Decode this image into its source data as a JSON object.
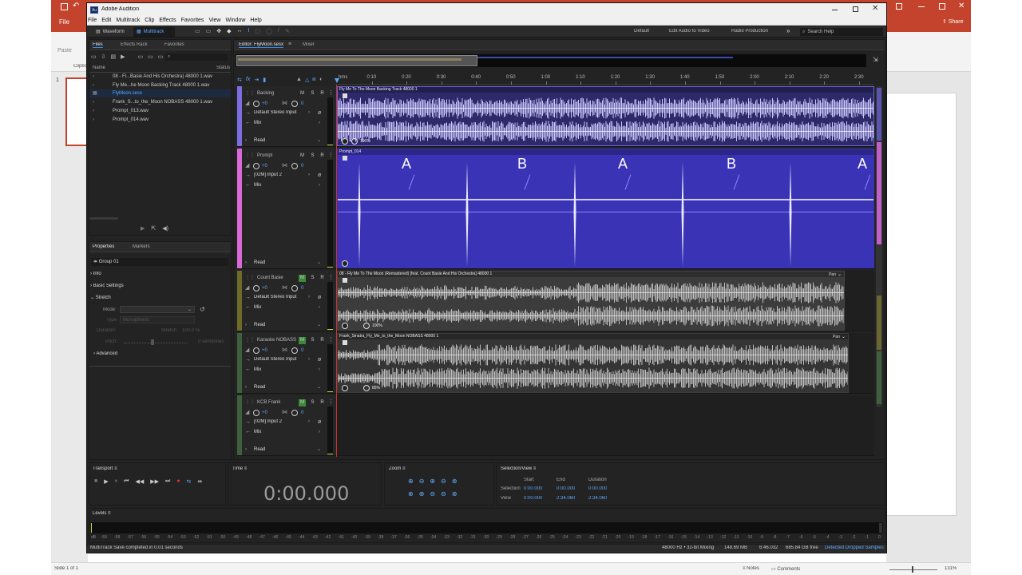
{
  "ppt": {
    "file_tab": "File",
    "undo_label": "Undo",
    "share_label": "Share",
    "clipboard_label": "Clipbo",
    "paste_label": "Paste",
    "slide_number": "1",
    "status_slide": "Slide 1 of 1",
    "notes_label": "Notes",
    "comments_label": "Comments",
    "zoom_level": "131%",
    "theme_color": "#c4432c"
  },
  "app": {
    "title": "Adobe Audition",
    "menu": [
      "File",
      "Edit",
      "Multitrack",
      "Clip",
      "Effects",
      "Favorites",
      "View",
      "Window",
      "Help"
    ],
    "toolbar": {
      "waveform_label": "Waveform",
      "multitrack_label": "Multitrack"
    },
    "workspaces": [
      "Default",
      "Edit Audio to Video",
      "Radio Production"
    ],
    "search_placeholder": "Search Help",
    "accent": "#2d8ceb"
  },
  "files_panel": {
    "tabs": [
      "Files",
      "Effects Rack",
      "Favorites"
    ],
    "col_name": "Name",
    "col_status": "Status",
    "items": [
      "08 - Fl...Basie And His Orchestra) 48000 1.wav",
      "Fly Me...he Moon Backing Track 48000 1.wav",
      "FlyMoon.sesx",
      "Frank_S...to_the_Moon NOBASS 48000 1.wav",
      "Prompt_013.wav",
      "Prompt_014.wav"
    ],
    "selected_index": 2
  },
  "properties_panel": {
    "tabs": [
      "Properties",
      "Markers"
    ],
    "group_value": "Group 01",
    "sections": [
      "Info",
      "Basic Settings",
      "Stretch",
      "Advanced"
    ],
    "mode_label": "Mode:",
    "type_label": "Type",
    "type_value": "Monophonic",
    "duration_label": "Duration:",
    "stretch_label": "Stretch:",
    "stretch_value": "100.0 %",
    "pitch_label": "Pitch:",
    "pitch_value": "0 semitones"
  },
  "editor": {
    "tabs": [
      "Editor: FlyMoon.sesx",
      "Mixer"
    ],
    "timecode_ticks": [
      "hms",
      "0:10",
      "0:20",
      "0:30",
      "0:40",
      "0:50",
      "1:00",
      "1:10",
      "1:20",
      "1:30",
      "1:40",
      "1:50",
      "2:00",
      "2:10",
      "2:20",
      "2:30"
    ],
    "tracks": [
      {
        "name": "Backing",
        "input": "Default Stereo Input",
        "mix": "Mix",
        "read": "Read",
        "vol": "+0",
        "pan": "0",
        "clip": "Fly Me To The Moon Backing Track 48000 1",
        "color": "#7c6ee0",
        "gain": "100%"
      },
      {
        "name": "Prompt",
        "input": "[02M] Input 2",
        "mix": "Mix",
        "read": "Read",
        "vol": "+0",
        "pan": "0",
        "clip": "Prompt_014",
        "color": "#d86ad8",
        "gain": ""
      },
      {
        "name": "Count Basie",
        "input": "Default Stereo Input",
        "mix": "Mix",
        "read": "Read",
        "vol": "+0",
        "pan": "0",
        "clip": "08 - Fly Me To The Moon (Remastered) [feat. Count Basie And His Orchestra] 48000 1",
        "color": "#6e6a2a",
        "gain": "100%",
        "pan_label": "Pan"
      },
      {
        "name": "Karaoke NOBASS",
        "input": "Default Stereo Input",
        "mix": "Mix",
        "read": "Read",
        "vol": "+0",
        "pan": "0",
        "clip": "Frank_Sinatra_Fly_Me_to_the_Moon NOBASS 48000 1",
        "color": "#3f5f3f",
        "gain": "85%",
        "pan_label": "Pan"
      },
      {
        "name": "KCB Frank",
        "input": "[02M] Input 2",
        "mix": "Mix",
        "read": "Read",
        "vol": "+0",
        "pan": "0",
        "clip": "",
        "color": "#3f5f3f",
        "gain": ""
      }
    ],
    "markers": [
      "A",
      "B",
      "A",
      "B",
      "A"
    ],
    "button_m": "M",
    "button_s": "S",
    "button_r": "R"
  },
  "transport": {
    "title": "Transport",
    "time_title": "Time",
    "time_value": "0:00.000",
    "zoom_title": "Zoom",
    "selection_title": "Selection/View",
    "col_start": "Start",
    "col_end": "End",
    "col_duration": "Duration",
    "row_selection": "Selection",
    "row_view": "View",
    "selection": [
      "0:00.000",
      "0:00.000",
      "0:00.000"
    ],
    "view": [
      "0:00.000",
      "2:34.060",
      "2:34.060"
    ]
  },
  "levels": {
    "title": "Levels",
    "scale": [
      "dB",
      "-59",
      "-58",
      "-57",
      "-56",
      "-55",
      "-54",
      "-53",
      "-52",
      "-51",
      "-50",
      "-49",
      "-48",
      "-47",
      "-46",
      "-45",
      "-44",
      "-43",
      "-42",
      "-41",
      "-40",
      "-39",
      "-38",
      "-37",
      "-36",
      "-35",
      "-34",
      "-33",
      "-32",
      "-31",
      "-30",
      "-29",
      "-28",
      "-27",
      "-26",
      "-25",
      "-24",
      "-23",
      "-22",
      "-21",
      "-20",
      "-19",
      "-18",
      "-17",
      "-16",
      "-15",
      "-14",
      "-13",
      "-12",
      "-11",
      "-10",
      "-9",
      "-8",
      "-7",
      "-6",
      "-5",
      "-4",
      "-3",
      "-2",
      "-1",
      "0"
    ]
  },
  "status": {
    "message": "MultiTrack Save completed in 0.01 seconds",
    "sample_info": "48000 Hz • 32-bit Mixing",
    "memory": "148.69 MB",
    "duration": "6:46.032",
    "disk_free": "685.84 GB free",
    "dropped": "Detected Dropped Samples"
  }
}
